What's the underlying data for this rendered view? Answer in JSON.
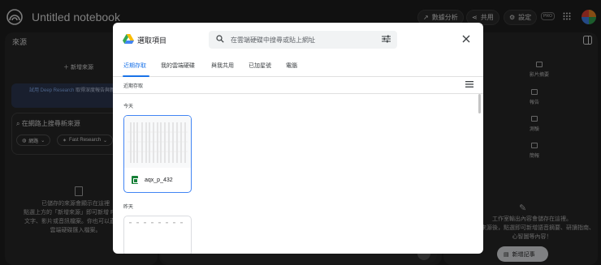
{
  "app": {
    "title": "Untitled notebook",
    "buttons": {
      "analytics": "數據分析",
      "share": "共用",
      "settings": "設定"
    },
    "pro_badge": "PRO"
  },
  "left_panel": {
    "title": "來源",
    "add_source": "新增來源",
    "deep_research": {
      "link": "試用 Deep Research",
      "text": " 取得深度報告與新來源！"
    },
    "web_search_prompt": "在網路上搜尋新來源",
    "chips": {
      "web": "網路",
      "fast_research": "Fast Research"
    },
    "empty_text_line1": "已儲存的來源會顯示在這裡",
    "empty_text_line2": "點選上方的「新增來源」即可新增 PDF、",
    "empty_text_line3": "文字、影片或音訊檔案。你也可以直接從",
    "empty_text_line4": "雲端硬碟匯入檔案。"
  },
  "right_panel": {
    "items": {
      "video_summary": "影片摘要",
      "report": "報告",
      "quiz": "測驗",
      "flashcards": "簡報"
    },
    "empty_line1": "工作室輸出內容會儲存在這裡。",
    "empty_line2": "新增來源後，點選即可新增語音摘要、研讀指南、",
    "empty_line3": "心智圖等內容！",
    "add_note": "新增記事"
  },
  "picker": {
    "title": "選取項目",
    "search_placeholder": "在雲端硬碟中搜尋或貼上網址",
    "tabs": [
      "近期存取",
      "我的雲端硬碟",
      "與我共用",
      "已加星號",
      "電腦"
    ],
    "sort_label": "近期存取",
    "section_today": "今天",
    "section_yesterday": "昨天",
    "files": [
      {
        "name": "aqx_p_432",
        "type": "sheets"
      }
    ],
    "colors": {
      "accent": "#1a73e8",
      "sheets": "#188038"
    }
  }
}
